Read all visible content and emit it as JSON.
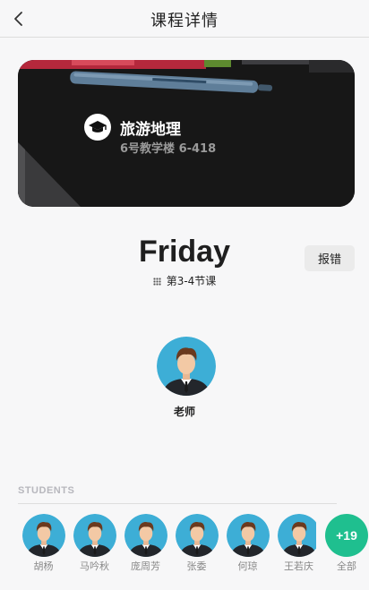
{
  "nav": {
    "title": "课程详情",
    "back_icon": "chevron-left-icon"
  },
  "course": {
    "name": "旅游地理",
    "location": "6号教学楼 6-418",
    "icon": "graduation-cap-icon"
  },
  "schedule": {
    "day": "Friday",
    "period": "第3-4节课"
  },
  "report_button": {
    "label": "报错"
  },
  "teacher": {
    "label": "老师"
  },
  "students": {
    "section_title": "STUDENTS",
    "list": [
      "胡杨",
      "马吟秋",
      "庞周芳",
      "张委",
      "何琼",
      "王若庆"
    ],
    "more_count": "+19",
    "more_label": "全部"
  },
  "colors": {
    "accent": "#1fbf8f",
    "avatar_bg": "#3daed6"
  }
}
